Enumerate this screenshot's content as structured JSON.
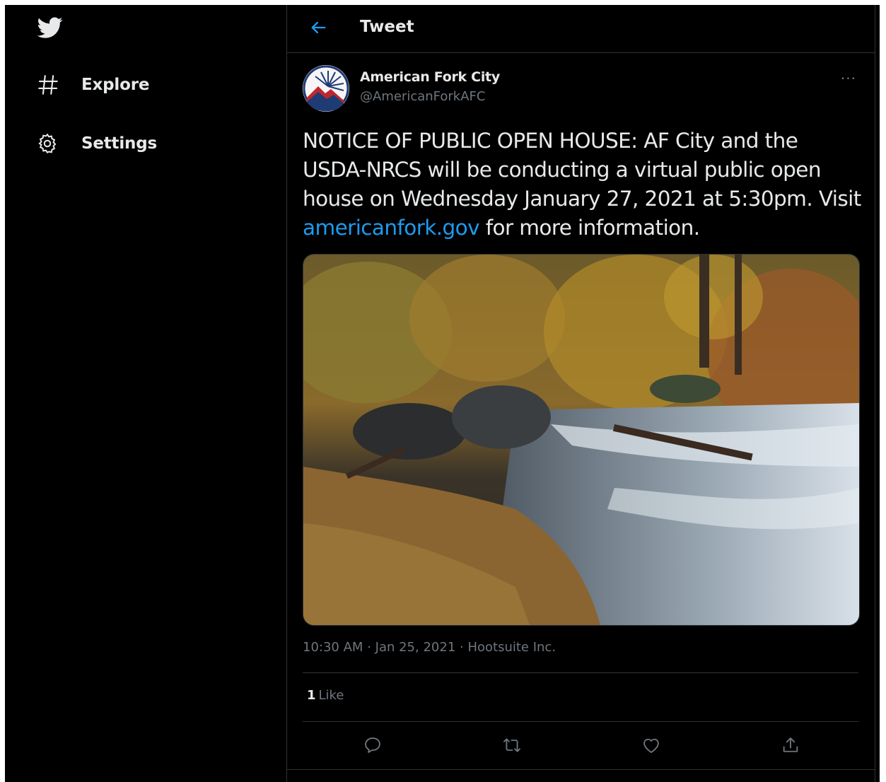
{
  "header": {
    "title": "Tweet"
  },
  "sidebar": {
    "items": [
      {
        "label": "Explore",
        "icon": "hashtag-icon"
      },
      {
        "label": "Settings",
        "icon": "gear-icon"
      }
    ]
  },
  "tweet": {
    "author_name": "American Fork City",
    "author_handle": "@AmericanForkAFC",
    "text_before_link": "NOTICE OF PUBLIC OPEN HOUSE: AF City and the USDA-NRCS will be conducting a virtual public open house on Wednesday January 27, 2021 at 5:30pm. Visit ",
    "link_text": "americanfork.gov",
    "text_after_link": " for more information.",
    "time": "10:30 AM",
    "date": "Jan 25, 2021",
    "source": "Hootsuite Inc.",
    "like_count": "1",
    "like_label": "Like"
  },
  "colors": {
    "background": "#000000",
    "accent": "#1d9bf0",
    "text": "#e7e9ea",
    "muted": "#6e767d",
    "border": "#2f3336"
  }
}
